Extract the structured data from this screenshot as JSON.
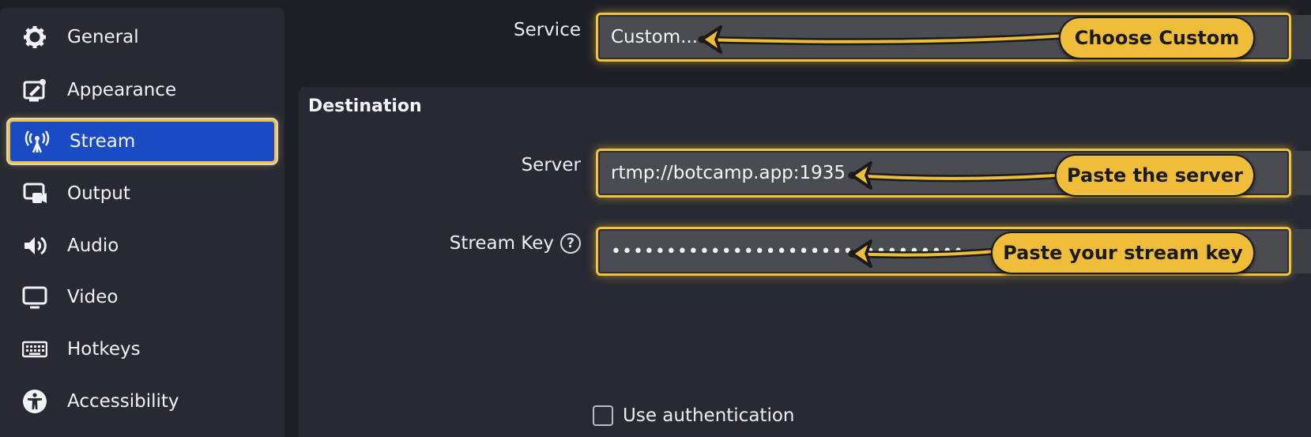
{
  "sidebar": {
    "items": [
      {
        "label": "General",
        "icon": "gear-icon"
      },
      {
        "label": "Appearance",
        "icon": "appearance-icon"
      },
      {
        "label": "Stream",
        "icon": "antenna-icon",
        "active": true
      },
      {
        "label": "Output",
        "icon": "output-icon"
      },
      {
        "label": "Audio",
        "icon": "speaker-icon"
      },
      {
        "label": "Video",
        "icon": "monitor-icon"
      },
      {
        "label": "Hotkeys",
        "icon": "keyboard-icon"
      },
      {
        "label": "Accessibility",
        "icon": "accessibility-icon"
      }
    ]
  },
  "main": {
    "service": {
      "label": "Service",
      "value": "Custom..."
    },
    "destination": {
      "title": "Destination",
      "server": {
        "label": "Server",
        "value": "rtmp://botcamp.app:1935"
      },
      "stream_key": {
        "label": "Stream Key",
        "help": "?",
        "value": "••••••••••••••••••••••••••••••••"
      }
    },
    "use_auth": {
      "label": "Use authentication",
      "checked": false
    }
  },
  "callouts": {
    "service": "Choose Custom",
    "server": "Paste the server",
    "stream_key": "Paste your stream key"
  },
  "colors": {
    "accent_highlight": "#f2c23a",
    "active_nav": "#1a4bc4",
    "callout_fill": "#f0bd3a"
  }
}
